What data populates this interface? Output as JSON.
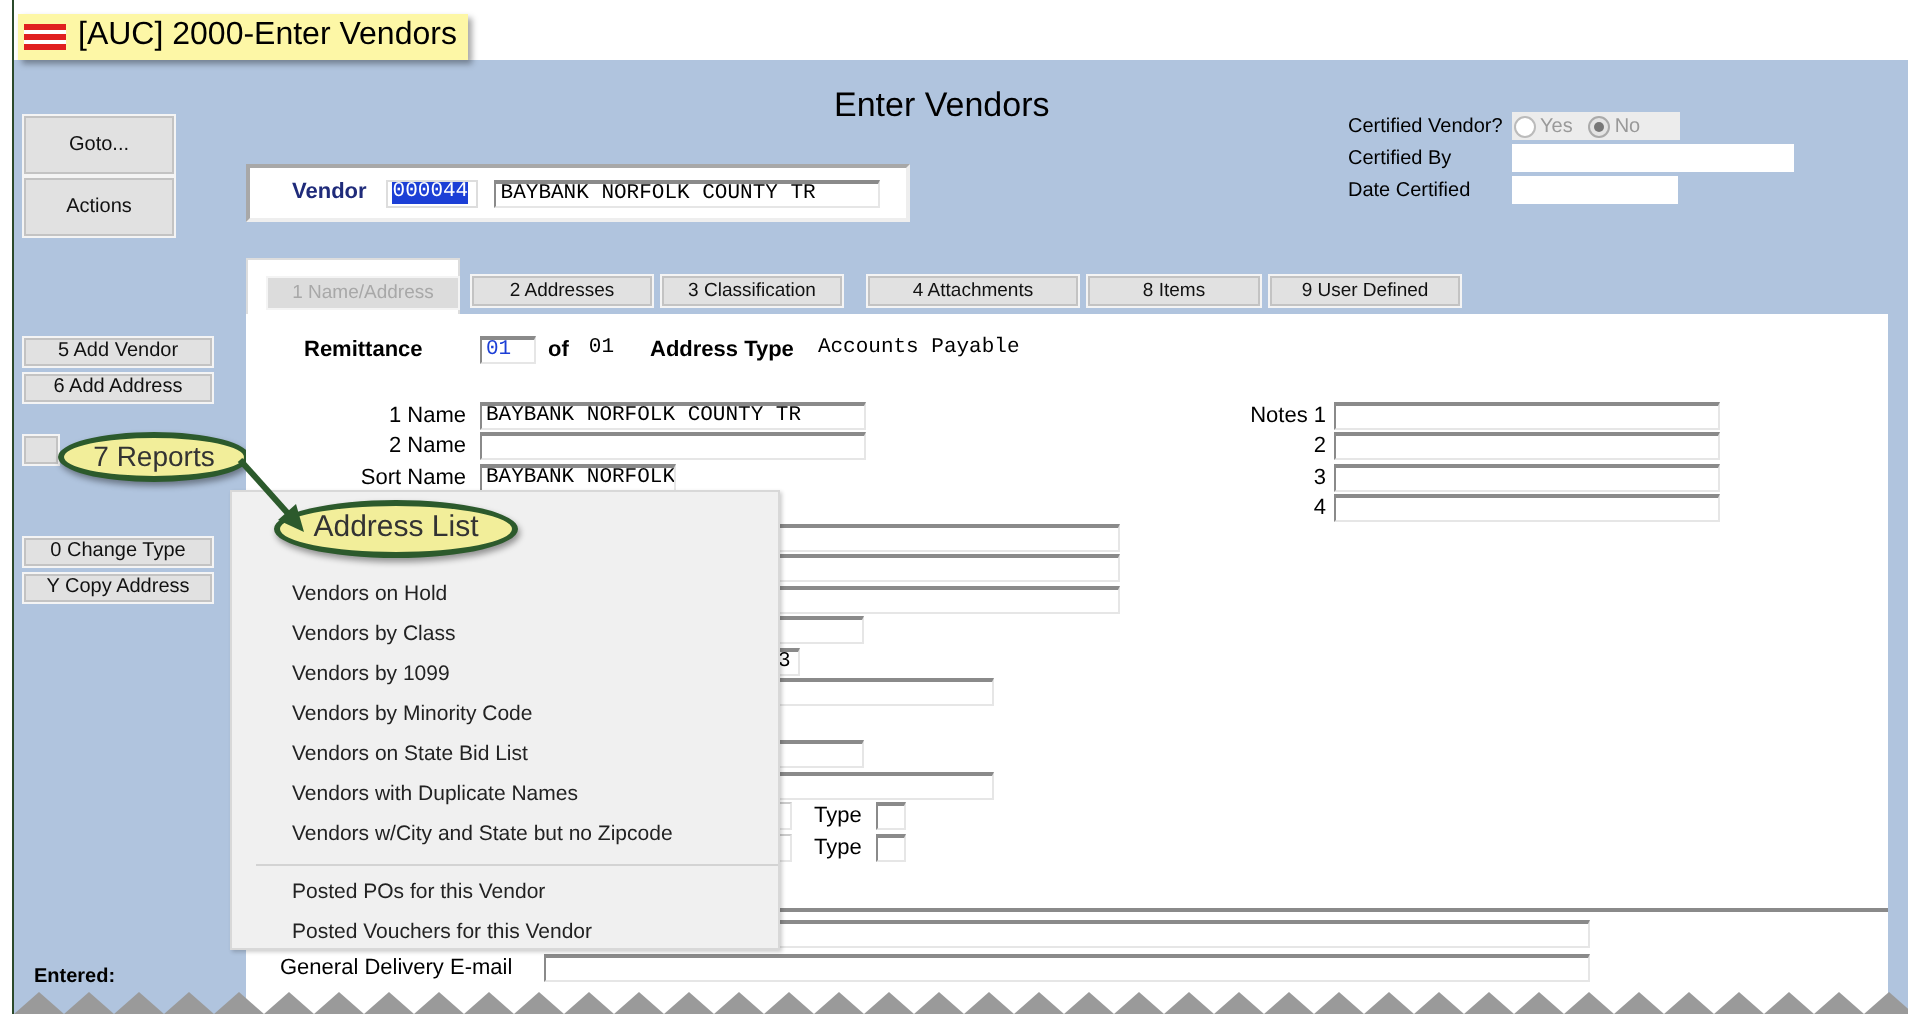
{
  "window": {
    "title": "[AUC] 2000-Enter Vendors"
  },
  "heading": "Enter Vendors",
  "side_groups": [
    [
      {
        "label": "Goto...",
        "kind": "large",
        "callout": false
      },
      {
        "label": "Actions",
        "kind": "large",
        "callout": false
      }
    ],
    [
      {
        "label": "5 Add Vendor",
        "kind": "small",
        "callout": false
      },
      {
        "label": "6 Add Address",
        "kind": "small",
        "callout": false
      }
    ],
    [
      {
        "label": "7 Reports",
        "kind": "small",
        "callout": true
      }
    ],
    [
      {
        "label": "0 Change Type",
        "kind": "small",
        "callout": false
      },
      {
        "label": "Y Copy Address",
        "kind": "small",
        "callout": false
      }
    ]
  ],
  "vendor": {
    "label": "Vendor",
    "code": "000044",
    "code_selected": true,
    "name": "BAYBANK NORFOLK COUNTY TR"
  },
  "certification": {
    "label": "Certified Vendor?",
    "disabled": true,
    "options": [
      {
        "label": "Yes",
        "selected": false
      },
      {
        "label": "No",
        "selected": true
      }
    ],
    "by_label": "Certified By",
    "date_label": "Date Certified"
  },
  "tabs": [
    {
      "label": "1 Name/Address",
      "selected": true
    },
    {
      "label": "2 Addresses",
      "selected": false
    },
    {
      "label": "3 Classification",
      "selected": false
    },
    {
      "label": "4 Attachments",
      "selected": false
    },
    {
      "label": "8 Items",
      "selected": false
    },
    {
      "label": "9 User Defined",
      "selected": false
    }
  ],
  "remittance": {
    "label": "Remittance",
    "value": "01",
    "of_label": "of",
    "total": "01",
    "type_label": "Address Type",
    "type_value": "Accounts Payable"
  },
  "names": [
    {
      "label": "1 Name",
      "value": "BAYBANK NORFOLK COUNTY TR"
    },
    {
      "label": "2 Name"
    },
    {
      "label": "Sort Name",
      "value": "BAYBANK NORFOLK"
    }
  ],
  "notes": [
    {
      "label": "Notes 1"
    },
    {
      "label": "2"
    },
    {
      "label": "3"
    },
    {
      "label": "4"
    }
  ],
  "covered_fields": [
    {
      "kind": "long"
    },
    {
      "kind": "long"
    },
    {
      "kind": "long"
    },
    {
      "kind": "short"
    },
    {
      "kind": "tiny",
      "value": "3"
    },
    {
      "kind": "medium"
    },
    {
      "kind": "gap"
    },
    {
      "kind": "short"
    },
    {
      "kind": "medium"
    },
    {
      "kind": "type",
      "label": "Type"
    },
    {
      "kind": "type",
      "label": "Type"
    }
  ],
  "email": {
    "label": "General Delivery E-mail"
  },
  "footer": {
    "label": "Entered:"
  },
  "reports_menu": {
    "groups": [
      [
        {
          "label": "Address List",
          "callout": true
        },
        {
          "label": "Vendors on Hold",
          "callout": false
        },
        {
          "label": "Vendors by Class",
          "callout": false
        },
        {
          "label": "Vendors by 1099",
          "callout": false
        },
        {
          "label": "Vendors by Minority Code",
          "callout": false
        },
        {
          "label": "Vendors on State Bid List",
          "callout": false
        },
        {
          "label": "Vendors with Duplicate Names",
          "callout": false
        },
        {
          "label": "Vendors w/City and State but no Zipcode",
          "callout": false
        }
      ],
      [
        {
          "label": "Posted POs for this Vendor",
          "callout": false
        },
        {
          "label": "Posted Vouchers for this Vendor",
          "callout": false
        }
      ]
    ]
  }
}
